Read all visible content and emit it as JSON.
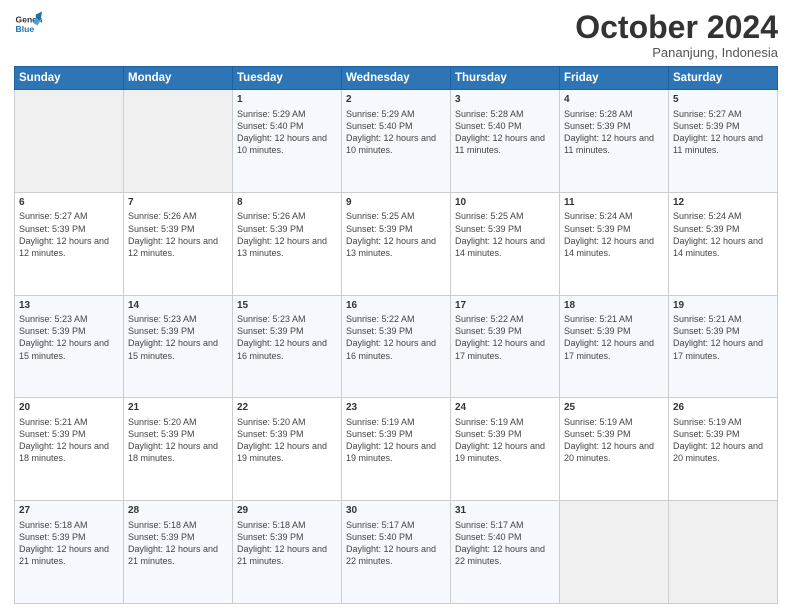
{
  "logo": {
    "line1": "General",
    "line2": "Blue"
  },
  "header": {
    "month": "October 2024",
    "location": "Pananjung, Indonesia"
  },
  "days_of_week": [
    "Sunday",
    "Monday",
    "Tuesday",
    "Wednesday",
    "Thursday",
    "Friday",
    "Saturday"
  ],
  "weeks": [
    [
      {
        "day": "",
        "info": ""
      },
      {
        "day": "",
        "info": ""
      },
      {
        "day": "1",
        "info": "Sunrise: 5:29 AM\nSunset: 5:40 PM\nDaylight: 12 hours and 10 minutes."
      },
      {
        "day": "2",
        "info": "Sunrise: 5:29 AM\nSunset: 5:40 PM\nDaylight: 12 hours and 10 minutes."
      },
      {
        "day": "3",
        "info": "Sunrise: 5:28 AM\nSunset: 5:40 PM\nDaylight: 12 hours and 11 minutes."
      },
      {
        "day": "4",
        "info": "Sunrise: 5:28 AM\nSunset: 5:39 PM\nDaylight: 12 hours and 11 minutes."
      },
      {
        "day": "5",
        "info": "Sunrise: 5:27 AM\nSunset: 5:39 PM\nDaylight: 12 hours and 11 minutes."
      }
    ],
    [
      {
        "day": "6",
        "info": "Sunrise: 5:27 AM\nSunset: 5:39 PM\nDaylight: 12 hours and 12 minutes."
      },
      {
        "day": "7",
        "info": "Sunrise: 5:26 AM\nSunset: 5:39 PM\nDaylight: 12 hours and 12 minutes."
      },
      {
        "day": "8",
        "info": "Sunrise: 5:26 AM\nSunset: 5:39 PM\nDaylight: 12 hours and 13 minutes."
      },
      {
        "day": "9",
        "info": "Sunrise: 5:25 AM\nSunset: 5:39 PM\nDaylight: 12 hours and 13 minutes."
      },
      {
        "day": "10",
        "info": "Sunrise: 5:25 AM\nSunset: 5:39 PM\nDaylight: 12 hours and 14 minutes."
      },
      {
        "day": "11",
        "info": "Sunrise: 5:24 AM\nSunset: 5:39 PM\nDaylight: 12 hours and 14 minutes."
      },
      {
        "day": "12",
        "info": "Sunrise: 5:24 AM\nSunset: 5:39 PM\nDaylight: 12 hours and 14 minutes."
      }
    ],
    [
      {
        "day": "13",
        "info": "Sunrise: 5:23 AM\nSunset: 5:39 PM\nDaylight: 12 hours and 15 minutes."
      },
      {
        "day": "14",
        "info": "Sunrise: 5:23 AM\nSunset: 5:39 PM\nDaylight: 12 hours and 15 minutes."
      },
      {
        "day": "15",
        "info": "Sunrise: 5:23 AM\nSunset: 5:39 PM\nDaylight: 12 hours and 16 minutes."
      },
      {
        "day": "16",
        "info": "Sunrise: 5:22 AM\nSunset: 5:39 PM\nDaylight: 12 hours and 16 minutes."
      },
      {
        "day": "17",
        "info": "Sunrise: 5:22 AM\nSunset: 5:39 PM\nDaylight: 12 hours and 17 minutes."
      },
      {
        "day": "18",
        "info": "Sunrise: 5:21 AM\nSunset: 5:39 PM\nDaylight: 12 hours and 17 minutes."
      },
      {
        "day": "19",
        "info": "Sunrise: 5:21 AM\nSunset: 5:39 PM\nDaylight: 12 hours and 17 minutes."
      }
    ],
    [
      {
        "day": "20",
        "info": "Sunrise: 5:21 AM\nSunset: 5:39 PM\nDaylight: 12 hours and 18 minutes."
      },
      {
        "day": "21",
        "info": "Sunrise: 5:20 AM\nSunset: 5:39 PM\nDaylight: 12 hours and 18 minutes."
      },
      {
        "day": "22",
        "info": "Sunrise: 5:20 AM\nSunset: 5:39 PM\nDaylight: 12 hours and 19 minutes."
      },
      {
        "day": "23",
        "info": "Sunrise: 5:19 AM\nSunset: 5:39 PM\nDaylight: 12 hours and 19 minutes."
      },
      {
        "day": "24",
        "info": "Sunrise: 5:19 AM\nSunset: 5:39 PM\nDaylight: 12 hours and 19 minutes."
      },
      {
        "day": "25",
        "info": "Sunrise: 5:19 AM\nSunset: 5:39 PM\nDaylight: 12 hours and 20 minutes."
      },
      {
        "day": "26",
        "info": "Sunrise: 5:19 AM\nSunset: 5:39 PM\nDaylight: 12 hours and 20 minutes."
      }
    ],
    [
      {
        "day": "27",
        "info": "Sunrise: 5:18 AM\nSunset: 5:39 PM\nDaylight: 12 hours and 21 minutes."
      },
      {
        "day": "28",
        "info": "Sunrise: 5:18 AM\nSunset: 5:39 PM\nDaylight: 12 hours and 21 minutes."
      },
      {
        "day": "29",
        "info": "Sunrise: 5:18 AM\nSunset: 5:39 PM\nDaylight: 12 hours and 21 minutes."
      },
      {
        "day": "30",
        "info": "Sunrise: 5:17 AM\nSunset: 5:40 PM\nDaylight: 12 hours and 22 minutes."
      },
      {
        "day": "31",
        "info": "Sunrise: 5:17 AM\nSunset: 5:40 PM\nDaylight: 12 hours and 22 minutes."
      },
      {
        "day": "",
        "info": ""
      },
      {
        "day": "",
        "info": ""
      }
    ]
  ]
}
